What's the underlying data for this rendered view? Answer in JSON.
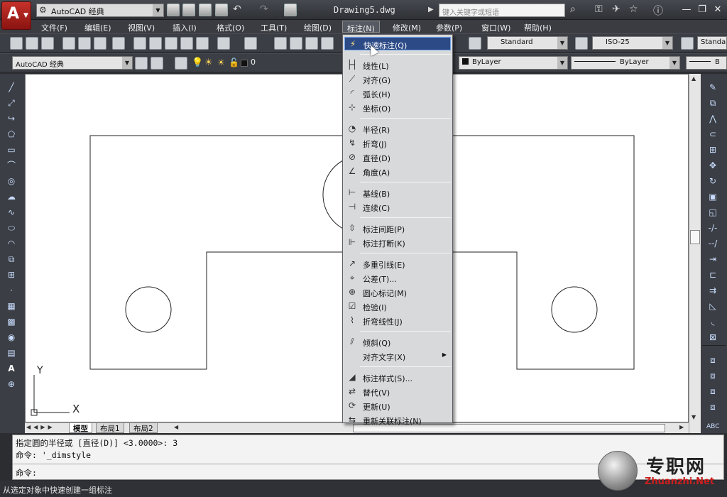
{
  "titlebar": {
    "workspace": "AutoCAD 经典",
    "document_title": "Drawing5.dwg",
    "search_placeholder": "键入关键字或短语"
  },
  "menubar": [
    "文件(F)",
    "编辑(E)",
    "视图(V)",
    "插入(I)",
    "格式(O)",
    "工具(T)",
    "绘图(D)",
    "标注(N)",
    "修改(M)",
    "参数(P)",
    "窗口(W)",
    "帮助(H)"
  ],
  "toolbar2": {
    "text_style": "Standard",
    "dim_style": "ISO-25",
    "table_style": "Standard"
  },
  "toolbar3": {
    "workspace": "AutoCAD 经典",
    "layer": "0",
    "color": "ByLayer",
    "linetype": "ByLayer",
    "lineweight": "B"
  },
  "dimension_menu": {
    "groups": [
      [
        {
          "label": "快速标注(Q)",
          "icon": "quick-dim-icon",
          "highlighted": true
        }
      ],
      [
        {
          "label": "线性(L)",
          "icon": "linear-icon"
        },
        {
          "label": "对齐(G)",
          "icon": "aligned-icon"
        },
        {
          "label": "弧长(H)",
          "icon": "arc-length-icon"
        },
        {
          "label": "坐标(O)",
          "icon": "ordinate-icon"
        }
      ],
      [
        {
          "label": "半径(R)",
          "icon": "radius-icon"
        },
        {
          "label": "折弯(J)",
          "icon": "jogged-icon"
        },
        {
          "label": "直径(D)",
          "icon": "diameter-icon"
        },
        {
          "label": "角度(A)",
          "icon": "angle-icon"
        }
      ],
      [
        {
          "label": "基线(B)",
          "icon": "baseline-icon"
        },
        {
          "label": "连续(C)",
          "icon": "continue-icon"
        }
      ],
      [
        {
          "label": "标注间距(P)",
          "icon": "dim-space-icon"
        },
        {
          "label": "标注打断(K)",
          "icon": "dim-break-icon"
        }
      ],
      [
        {
          "label": "多重引线(E)",
          "icon": "multileader-icon"
        },
        {
          "label": "公差(T)...",
          "icon": "tolerance-icon"
        },
        {
          "label": "圆心标记(M)",
          "icon": "center-mark-icon"
        },
        {
          "label": "检验(I)",
          "icon": "inspection-icon"
        },
        {
          "label": "折弯线性(J)",
          "icon": "jogged-linear-icon"
        }
      ],
      [
        {
          "label": "倾斜(Q)",
          "icon": "oblique-icon"
        },
        {
          "label": "对齐文字(X)",
          "icon": "",
          "submenu": true
        }
      ],
      [
        {
          "label": "标注样式(S)...",
          "icon": "dim-style-icon"
        },
        {
          "label": "替代(V)",
          "icon": "override-icon"
        },
        {
          "label": "更新(U)",
          "icon": "update-icon"
        },
        {
          "label": "重新关联标注(N)",
          "icon": "reassociate-icon"
        }
      ]
    ]
  },
  "layout_tabs": [
    "模型",
    "布局1",
    "布局2"
  ],
  "ucs": {
    "x": "X",
    "y": "Y"
  },
  "command": {
    "line1": "指定圆的半径或 [直径(D)] <3.0000>: 3",
    "line2": "命令: '_dimstyle",
    "prompt": "命令:"
  },
  "status_text": "从选定对象中快速创建一组标注",
  "watermark": {
    "title": "专职网",
    "url": "Zhuanzhi.Net"
  }
}
